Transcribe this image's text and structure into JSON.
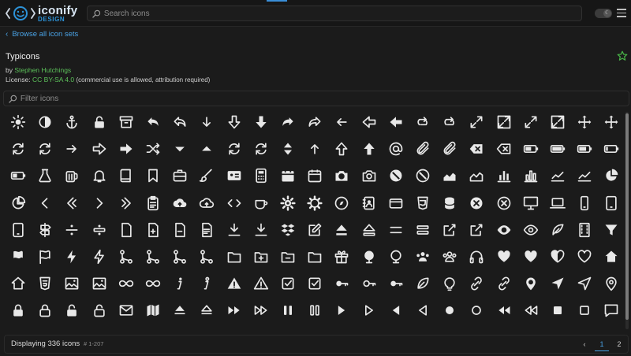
{
  "header": {
    "logo_main": "iconify",
    "logo_sub": "DESIGN",
    "search_placeholder": "Search icons",
    "theme_icon": "moon-icon",
    "menu_icon": "hamburger-icon"
  },
  "nav": {
    "browse_label": "Browse all icon sets"
  },
  "iconset": {
    "title": "Typicons",
    "author_prefix": "by",
    "author": "Stephen Hutchings",
    "license_prefix": "License:",
    "license": "CC BY-SA 4.0",
    "license_note": "(commercial use is allowed, attribution required)"
  },
  "filter": {
    "placeholder": "Filter icons"
  },
  "icons": {
    "columns": 23,
    "rows": [
      [
        "sun",
        "adjust-contrast",
        "anchor",
        "lock-open",
        "archive",
        "arrow-back",
        "arrow-back-outline",
        "arrow-down",
        "arrow-down-outline",
        "arrow-down-thick",
        "arrow-forward",
        "arrow-forward-outline",
        "arrow-left",
        "arrow-left-outline",
        "arrow-left-thick",
        "arrow-loop",
        "arrow-loop-outline",
        "arrow-maximise",
        "arrow-maximise-outline",
        "arrow-minimise",
        "arrow-minimise-outline",
        "arrow-move",
        "arrow-move-outline"
      ],
      [
        "arrow-repeat",
        "arrow-repeat-outline",
        "arrow-right",
        "arrow-right-outline",
        "arrow-right-thick",
        "arrow-shuffle",
        "arrow-sorted-down",
        "arrow-sorted-up",
        "arrow-sync",
        "arrow-sync-outline",
        "arrow-unsorted",
        "arrow-up",
        "arrow-up-outline",
        "arrow-up-thick",
        "at",
        "attachment",
        "attachment-outline",
        "backspace",
        "backspace-outline",
        "battery-charge",
        "battery-full",
        "battery-high",
        "battery-low"
      ],
      [
        "battery-mid",
        "beaker",
        "beer",
        "bell",
        "book",
        "bookmark",
        "briefcase",
        "brush",
        "business-card",
        "calculator",
        "calendar",
        "calendar-outline",
        "camera",
        "camera-outline",
        "cancel",
        "cancel-outline",
        "chart-area",
        "chart-area-outline",
        "chart-bar",
        "chart-bar-outline",
        "chart-line",
        "chart-line-outline",
        "chart-pie"
      ],
      [
        "chart-pie-outline",
        "chevron-left",
        "chevron-left-outline",
        "chevron-right",
        "chevron-right-outline",
        "clipboard",
        "cloud-storage",
        "cloud-storage-outline",
        "code",
        "coffee",
        "cog",
        "cog-outline",
        "compass",
        "contacts",
        "credit-card",
        "css3",
        "database",
        "delete",
        "delete-outline",
        "device-desktop",
        "device-laptop",
        "device-phone",
        "device-tablet"
      ],
      [
        "device-tablet-alt",
        "directions",
        "divide",
        "divide-outline",
        "document",
        "document-add",
        "document-delete",
        "document-text",
        "download",
        "download-outline",
        "dropbox",
        "edit",
        "eject",
        "eject-outline",
        "equals",
        "equals-outline",
        "export",
        "export-outline",
        "eye",
        "eye-outline",
        "feather",
        "film",
        "filter"
      ],
      [
        "flag",
        "flag-outline",
        "flash",
        "flash-outline",
        "flow-children",
        "flow-merge",
        "flow-parallel",
        "flow-switch",
        "folder",
        "folder-add",
        "folder-delete",
        "folder-open",
        "gift",
        "globe",
        "globe-outline",
        "group",
        "group-outline",
        "headphones",
        "heart",
        "heart-full-outline",
        "heart-half-outline",
        "heart-outline",
        "home"
      ],
      [
        "home-outline",
        "html5",
        "image",
        "image-outline",
        "infinity",
        "infinity-outline",
        "info-large",
        "info-large-outline",
        "info",
        "info-outline",
        "input-checked",
        "input-checked-outline",
        "key",
        "key-outline",
        "keyboard",
        "leaf",
        "lightbulb",
        "link",
        "link-outline",
        "location",
        "location-arrow",
        "location-arrow-outline",
        "location-outline"
      ],
      [
        "lock-closed",
        "lock-closed-outline",
        "lock-open",
        "lock-open-outline",
        "mail",
        "map",
        "media-eject",
        "media-eject-outline",
        "media-fast-forward",
        "media-fast-forward-outline",
        "media-pause",
        "media-pause-outline",
        "media-play",
        "media-play-outline",
        "media-play-reverse",
        "media-play-reverse-outline",
        "media-record",
        "media-record-outline",
        "media-rewind",
        "media-rewind-outline",
        "media-stop",
        "media-stop-outline",
        "message"
      ]
    ]
  },
  "footer": {
    "displaying": "Displaying 336 icons",
    "range": "# 1-207",
    "pages": [
      "1",
      "2"
    ],
    "current_page": "1"
  },
  "colors": {
    "accent": "#4aa3e6",
    "link_green": "#5cc05a",
    "star_green": "#49b548",
    "background": "#1b1b1b"
  }
}
